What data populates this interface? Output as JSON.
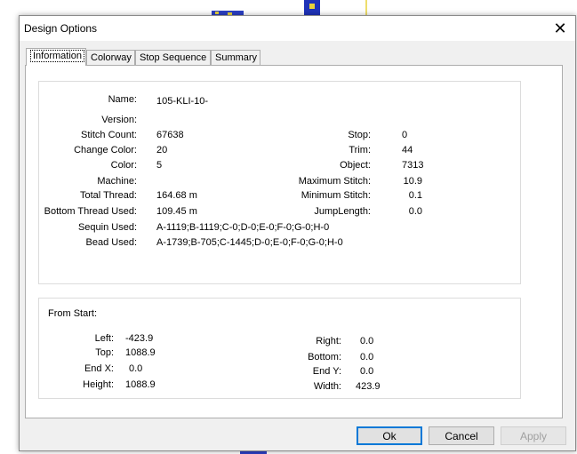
{
  "window": {
    "title": "Design Options",
    "close_symbol": "✕"
  },
  "tabs": [
    {
      "label": "Information",
      "active": true
    },
    {
      "label": "Colorway",
      "active": false
    },
    {
      "label": "Stop Sequence",
      "active": false
    },
    {
      "label": "Summary",
      "active": false
    }
  ],
  "info": {
    "name_label": "Name:",
    "name_value": "105-KLI-10-",
    "version_label": "Version:",
    "version_value": "",
    "stitch_count_label": "Stitch Count:",
    "stitch_count_value": "67638",
    "change_color_label": "Change Color:",
    "change_color_value": "20",
    "color_label": "Color:",
    "color_value": "5",
    "machine_label": "Machine:",
    "machine_value": "",
    "total_thread_label": "Total Thread:",
    "total_thread_value": "164.68 m",
    "bottom_thread_label": "Bottom Thread Used:",
    "bottom_thread_value": "109.45 m",
    "sequin_label": "Sequin Used:",
    "sequin_value": "A-1119;B-1119;C-0;D-0;E-0;F-0;G-0;H-0",
    "bead_label": "Bead Used:",
    "bead_value": "A-1739;B-705;C-1445;D-0;E-0;F-0;G-0;H-0",
    "stop_label": "Stop:",
    "stop_value": "0",
    "trim_label": "Trim:",
    "trim_value": "44",
    "object_label": "Object:",
    "object_value": "7313",
    "max_stitch_label": "Maximum Stitch:",
    "max_stitch_value": "10.9",
    "min_stitch_label": "Minimum Stitch:",
    "min_stitch_value": "0.1",
    "jump_label": "JumpLength:",
    "jump_value": "0.0"
  },
  "from_start": {
    "title": "From Start:",
    "left_label": "Left:",
    "left_value": "-423.9",
    "top_label": "Top:",
    "top_value": "1088.9",
    "endx_label": "End X:",
    "endx_value": "0.0",
    "height_label": "Height:",
    "height_value": "1088.9",
    "right_label": "Right:",
    "right_value": "0.0",
    "bottom_label": "Bottom:",
    "bottom_value": "0.0",
    "endy_label": "End Y:",
    "endy_value": "0.0",
    "width_label": "Width:",
    "width_value": "423.9"
  },
  "buttons": {
    "ok": "Ok",
    "cancel": "Cancel",
    "apply": "Apply"
  }
}
